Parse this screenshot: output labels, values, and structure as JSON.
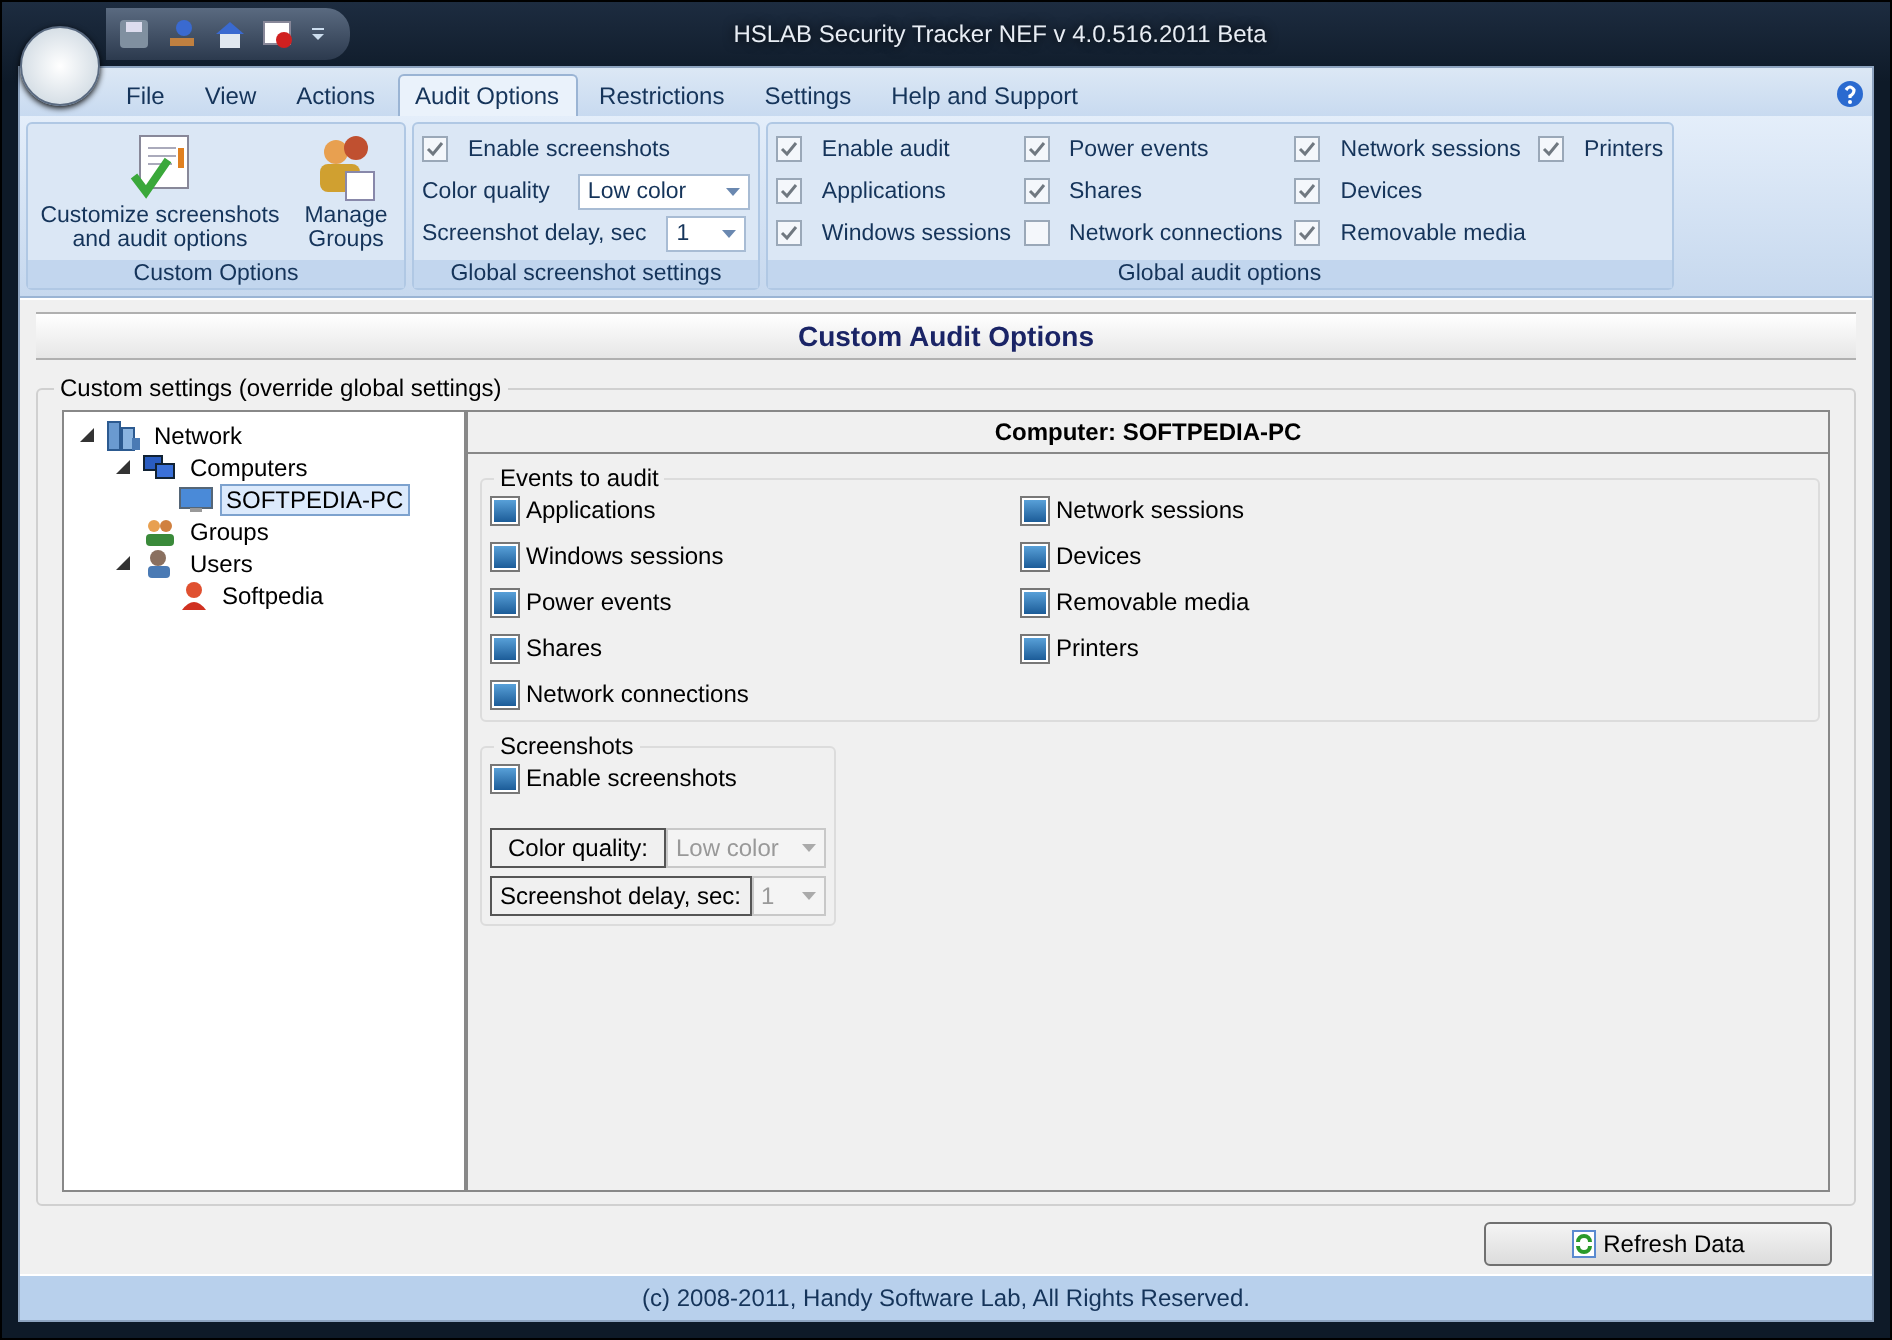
{
  "window": {
    "title": "HSLAB Security Tracker NEF v 4.0.516.2011 Beta"
  },
  "menu_tabs": [
    {
      "label": "File",
      "selected": false
    },
    {
      "label": "View",
      "selected": false
    },
    {
      "label": "Actions",
      "selected": false
    },
    {
      "label": "Audit Options",
      "selected": true
    },
    {
      "label": "Restrictions",
      "selected": false
    },
    {
      "label": "Settings",
      "selected": false
    },
    {
      "label": "Help and Support",
      "selected": false
    }
  ],
  "ribbon": {
    "custom_options": {
      "caption": "Custom Options",
      "buttons": [
        {
          "label": "Customize screenshots and audit options",
          "kind": "customize"
        },
        {
          "label": "Manage Groups",
          "kind": "groups"
        }
      ]
    },
    "global_screenshot_settings": {
      "caption": "Global screenshot settings",
      "enable": {
        "label": "Enable screenshots",
        "checked": true
      },
      "fields": [
        {
          "label": "Color quality",
          "value": "Low color"
        },
        {
          "label": "Screenshot delay, sec",
          "value": "1"
        }
      ]
    },
    "global_audit_options": {
      "caption": "Global audit options",
      "columns": [
        [
          {
            "label": "Enable audit",
            "checked": true
          },
          {
            "label": "Applications",
            "checked": true
          },
          {
            "label": "Windows sessions",
            "checked": true
          }
        ],
        [
          {
            "label": "Power events",
            "checked": true
          },
          {
            "label": "Shares",
            "checked": true
          },
          {
            "label": "Network connections",
            "checked": false
          }
        ],
        [
          {
            "label": "Network sessions",
            "checked": true
          },
          {
            "label": "Devices",
            "checked": true
          },
          {
            "label": "Removable media",
            "checked": true
          }
        ],
        [
          {
            "label": "Printers",
            "checked": true
          }
        ]
      ]
    }
  },
  "page": {
    "title": "Custom Audit Options",
    "group_title": "Custom settings (override global settings)",
    "tree": [
      {
        "label": "Network",
        "kind": "network",
        "expanded": true,
        "selected": false,
        "children": [
          {
            "label": "Computers",
            "kind": "computers",
            "expanded": true,
            "selected": false,
            "children": [
              {
                "label": "SOFTPEDIA-PC",
                "kind": "computer",
                "selected": true
              }
            ]
          },
          {
            "label": "Groups",
            "kind": "groups",
            "selected": false
          },
          {
            "label": "Users",
            "kind": "users",
            "expanded": true,
            "selected": false,
            "children": [
              {
                "label": "Softpedia",
                "kind": "user",
                "selected": false
              }
            ]
          }
        ]
      }
    ],
    "detail": {
      "title": "Computer: SOFTPEDIA-PC",
      "events": {
        "title": "Events to audit",
        "columns": [
          [
            {
              "label": "Applications",
              "checked": true
            },
            {
              "label": "Windows sessions",
              "checked": true
            },
            {
              "label": "Power events",
              "checked": true
            },
            {
              "label": "Shares",
              "checked": true
            },
            {
              "label": "Network connections",
              "checked": true
            }
          ],
          [
            {
              "label": "Network sessions",
              "checked": true
            },
            {
              "label": "Devices",
              "checked": true
            },
            {
              "label": "Removable media",
              "checked": true
            },
            {
              "label": "Printers",
              "checked": true
            }
          ]
        ]
      },
      "screenshots": {
        "title": "Screenshots",
        "enable": {
          "label": "Enable screenshots",
          "checked": true
        },
        "fields": [
          {
            "label": "Color quality:",
            "value": "Low color"
          },
          {
            "label": "Screenshot delay, sec:",
            "value": "1"
          }
        ]
      }
    },
    "refresh_button": "Refresh Data"
  },
  "status_bar": "(c) 2008-2011, Handy Software Lab, All Rights Reserved."
}
